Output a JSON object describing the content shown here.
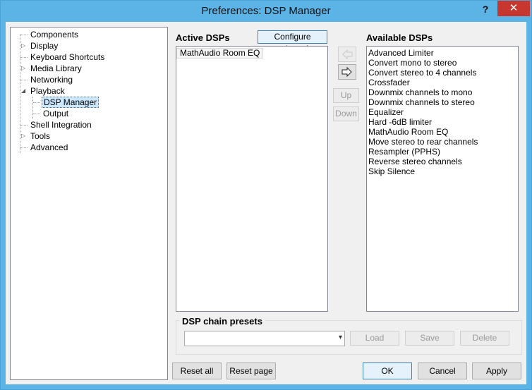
{
  "window": {
    "title": "Preferences: DSP Manager",
    "help_label": "?",
    "close_label": "✕"
  },
  "tree": {
    "items": [
      {
        "label": "Components"
      },
      {
        "label": "Display"
      },
      {
        "label": "Keyboard Shortcuts"
      },
      {
        "label": "Media Library"
      },
      {
        "label": "Networking"
      },
      {
        "label": "Playback"
      },
      {
        "label": "DSP Manager"
      },
      {
        "label": "Output"
      },
      {
        "label": "Shell Integration"
      },
      {
        "label": "Tools"
      },
      {
        "label": "Advanced"
      }
    ],
    "selected": "DSP Manager"
  },
  "active": {
    "heading": "Active DSPs",
    "configure_label": "Configure selected",
    "items": [
      "MathAudio Room EQ"
    ]
  },
  "available": {
    "heading": "Available DSPs",
    "items": [
      "Advanced Limiter",
      "Convert mono to stereo",
      "Convert stereo to 4 channels",
      "Crossfader",
      "Downmix channels to mono",
      "Downmix channels to stereo",
      "Equalizer",
      "Hard -6dB limiter",
      "MathAudio Room EQ",
      "Move stereo to rear channels",
      "Resampler (PPHS)",
      "Reverse stereo channels",
      "Skip Silence"
    ]
  },
  "middle": {
    "up_label": "Up",
    "down_label": "Down"
  },
  "presets": {
    "heading": "DSP chain presets",
    "combo_value": "",
    "load_label": "Load",
    "save_label": "Save",
    "delete_label": "Delete"
  },
  "footer": {
    "reset_all_label": "Reset all",
    "reset_page_label": "Reset page",
    "ok_label": "OK",
    "cancel_label": "Cancel",
    "apply_label": "Apply"
  }
}
